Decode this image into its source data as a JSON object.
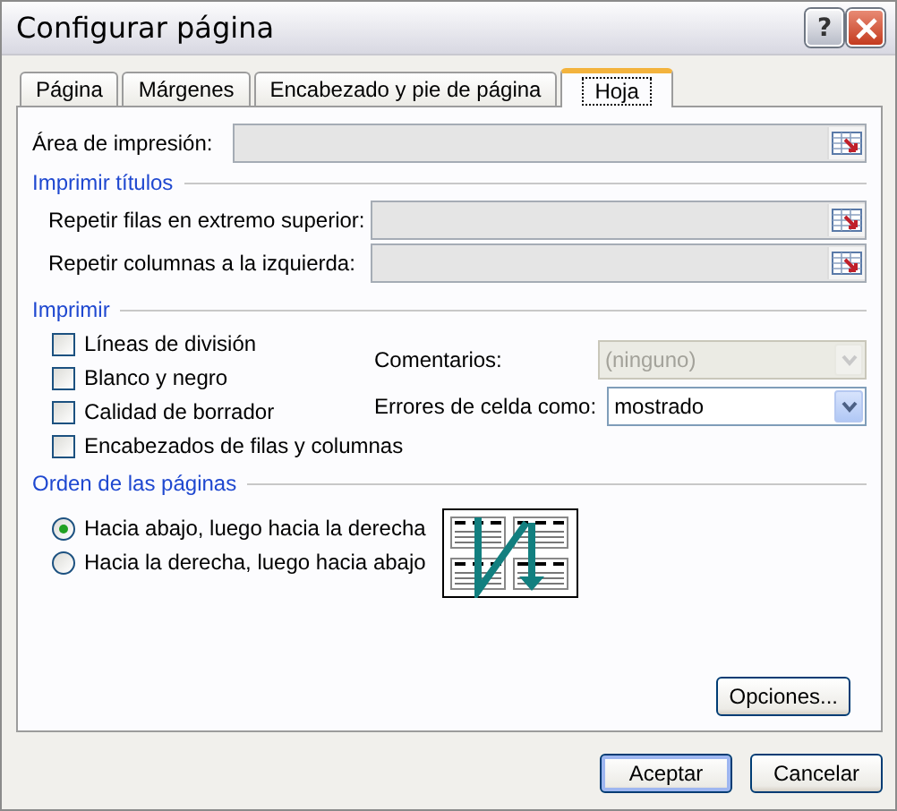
{
  "window": {
    "title": "Configurar página",
    "help": "?"
  },
  "tabs": [
    {
      "label": "Página",
      "selected": false
    },
    {
      "label": "Márgenes",
      "selected": false
    },
    {
      "label": "Encabezado y pie de página",
      "selected": false
    },
    {
      "label": "Hoja",
      "selected": true
    }
  ],
  "print_area": {
    "label": "Área de impresión:",
    "disabled": true
  },
  "print_titles": {
    "title": "Imprimir títulos",
    "fields": [
      {
        "label": "Repetir filas en extremo superior:",
        "disabled": true
      },
      {
        "label": "Repetir columnas a la izquierda:",
        "disabled": true
      }
    ]
  },
  "print": {
    "title": "Imprimir",
    "checkboxes": [
      {
        "label": "Líneas de división",
        "checked": false
      },
      {
        "label": "Blanco y negro",
        "checked": false
      },
      {
        "label": "Calidad de borrador",
        "checked": false
      },
      {
        "label": "Encabezados de filas y columnas",
        "checked": false
      }
    ],
    "dropdowns": [
      {
        "label": "Comentarios:",
        "value": "(ninguno)",
        "disabled": true
      },
      {
        "label": "Errores de celda como:",
        "value": "mostrado",
        "disabled": false
      }
    ]
  },
  "page_order": {
    "title": "Orden de las páginas",
    "options": [
      {
        "label": "Hacia abajo, luego hacia la derecha",
        "selected": true
      },
      {
        "label": "Hacia la derecha, luego hacia abajo",
        "selected": false
      }
    ]
  },
  "options_button": "Opciones...",
  "buttons": [
    "Aceptar",
    "Cancelar"
  ]
}
